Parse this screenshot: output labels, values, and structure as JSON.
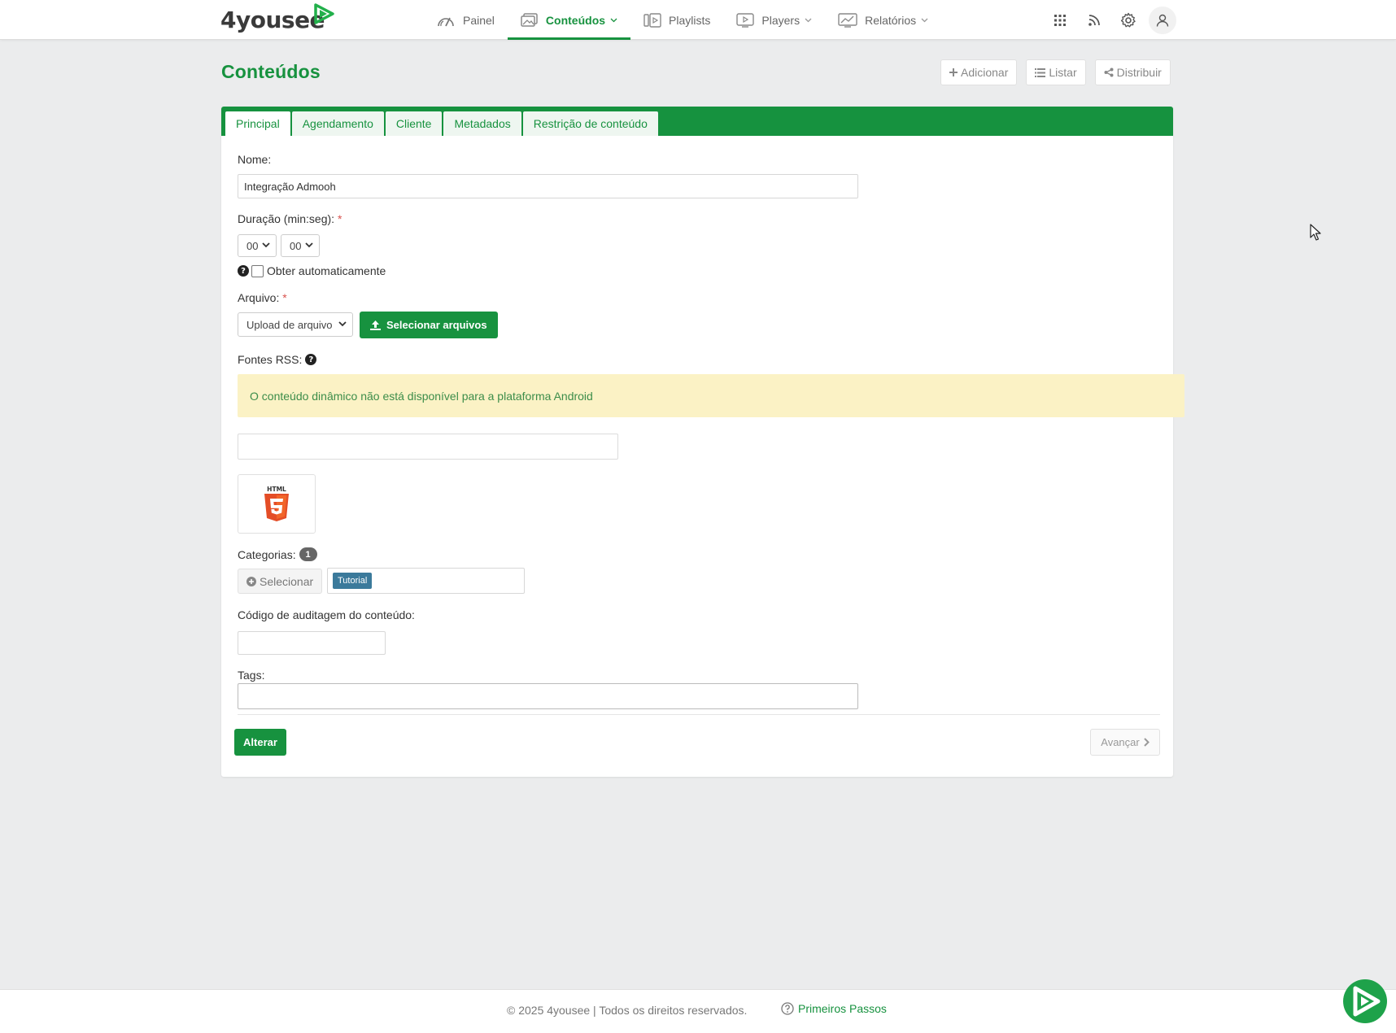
{
  "brand": {
    "name": "4yousee"
  },
  "nav": {
    "items": [
      {
        "label": "Painel"
      },
      {
        "label": "Conteúdos"
      },
      {
        "label": "Playlists"
      },
      {
        "label": "Players"
      },
      {
        "label": "Relatórios"
      }
    ],
    "active": "Conteúdos"
  },
  "top_icons": [
    "apps-grid-icon",
    "rss-icon",
    "gear-icon",
    "user-icon"
  ],
  "page": {
    "title": "Conteúdos",
    "actions": {
      "add": "Adicionar",
      "list": "Listar",
      "distribute": "Distribuir"
    }
  },
  "tabs": [
    {
      "label": "Principal",
      "active": true
    },
    {
      "label": "Agendamento"
    },
    {
      "label": "Cliente"
    },
    {
      "label": "Metadados"
    },
    {
      "label": "Restrição de conteúdo"
    }
  ],
  "form": {
    "name": {
      "label": "Nome:",
      "value": "Integração Admooh"
    },
    "duration": {
      "label": "Duração (min:seg):",
      "required_mark": "*",
      "minutes": "00",
      "seconds": "00"
    },
    "auto": {
      "label": "Obter automaticamente",
      "checked": false
    },
    "file": {
      "label": "Arquivo:",
      "required_mark": "*",
      "source": "Upload de arquivo",
      "select_button": "Selecionar arquivos"
    },
    "rss": {
      "label": "Fontes RSS:",
      "alert": "O conteúdo dinâmico não está disponível para a plataforma Android",
      "value": ""
    },
    "preview": {
      "type": "html5-icon",
      "caption": "HTML"
    },
    "categories": {
      "label": "Categorias:",
      "count": "1",
      "select_button": "Selecionar",
      "selected": [
        "Tutorial"
      ]
    },
    "audit": {
      "label": "Código de auditagem do conteúdo:",
      "value": ""
    },
    "tags": {
      "label": "Tags:",
      "value": ""
    },
    "submit": "Alterar",
    "next": "Avançar"
  },
  "footer": {
    "copyright": "© 2025 4yousee | Todos os direitos reservados.",
    "link": "Primeiros Passos"
  },
  "colors": {
    "brand_green": "#17923f",
    "alert_bg": "#fbf2c5",
    "tag_blue": "#3b7a9b",
    "html5_orange": "#e44d26"
  }
}
